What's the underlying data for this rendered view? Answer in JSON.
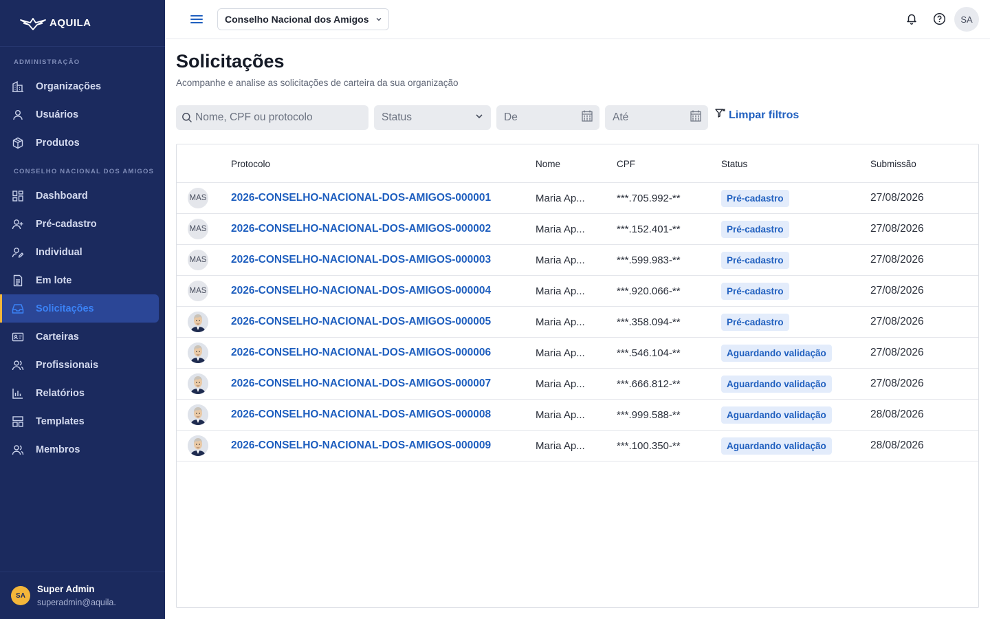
{
  "brand": {
    "name": "AQUILA"
  },
  "sidebar": {
    "section_admin": "ADMINISTRAÇÃO",
    "admin_items": [
      {
        "label": "Organizações",
        "icon": "building-icon"
      },
      {
        "label": "Usuários",
        "icon": "user-icon"
      },
      {
        "label": "Produtos",
        "icon": "package-icon"
      }
    ],
    "section_org": "CONSELHO NACIONAL DOS AMIGOS",
    "org_items": [
      {
        "label": "Dashboard",
        "icon": "dashboard-icon"
      },
      {
        "label": "Pré-cadastro",
        "icon": "user-plus-icon"
      },
      {
        "label": "Individual",
        "icon": "user-edit-icon"
      },
      {
        "label": "Em lote",
        "icon": "sheet-icon"
      },
      {
        "label": "Solicitações",
        "icon": "inbox-icon",
        "active": true
      },
      {
        "label": "Carteiras",
        "icon": "id-card-icon"
      },
      {
        "label": "Profissionais",
        "icon": "users-icon"
      },
      {
        "label": "Relatórios",
        "icon": "bar-chart-icon"
      },
      {
        "label": "Templates",
        "icon": "template-icon"
      },
      {
        "label": "Membros",
        "icon": "members-icon"
      }
    ],
    "user": {
      "initials": "SA",
      "name": "Super Admin",
      "email": "superadmin@aquila."
    }
  },
  "topbar": {
    "org_name": "Conselho Nacional dos Amigos",
    "avatar_initials": "SA"
  },
  "page": {
    "title": "Solicitações",
    "subtitle": "Acompanhe e analise as solicitações de carteira da sua organização"
  },
  "filters": {
    "search_placeholder": "Nome, CPF ou protocolo",
    "status_placeholder": "Status",
    "from_placeholder": "De",
    "to_placeholder": "Até",
    "clear_label": "Limpar filtros"
  },
  "table": {
    "headers": {
      "protocolo": "Protocolo",
      "nome": "Nome",
      "cpf": "CPF",
      "status": "Status",
      "submissao": "Submissão"
    },
    "rows": [
      {
        "avatar": "MAS",
        "protocolo": "2026-CONSELHO-NACIONAL-DOS-AMIGOS-000001",
        "nome": "Maria Ap...",
        "cpf": "***.705.992-**",
        "status": "Pré-cadastro",
        "submissao": "27/08/2026"
      },
      {
        "avatar": "MAS",
        "protocolo": "2026-CONSELHO-NACIONAL-DOS-AMIGOS-000002",
        "nome": "Maria Ap...",
        "cpf": "***.152.401-**",
        "status": "Pré-cadastro",
        "submissao": "27/08/2026"
      },
      {
        "avatar": "MAS",
        "protocolo": "2026-CONSELHO-NACIONAL-DOS-AMIGOS-000003",
        "nome": "Maria Ap...",
        "cpf": "***.599.983-**",
        "status": "Pré-cadastro",
        "submissao": "27/08/2026"
      },
      {
        "avatar": "MAS",
        "protocolo": "2026-CONSELHO-NACIONAL-DOS-AMIGOS-000004",
        "nome": "Maria Ap...",
        "cpf": "***.920.066-**",
        "status": "Pré-cadastro",
        "submissao": "27/08/2026"
      },
      {
        "avatar": "photo",
        "protocolo": "2026-CONSELHO-NACIONAL-DOS-AMIGOS-000005",
        "nome": "Maria Ap...",
        "cpf": "***.358.094-**",
        "status": "Pré-cadastro",
        "submissao": "27/08/2026"
      },
      {
        "avatar": "photo",
        "protocolo": "2026-CONSELHO-NACIONAL-DOS-AMIGOS-000006",
        "nome": "Maria Ap...",
        "cpf": "***.546.104-**",
        "status": "Aguardando validação",
        "submissao": "27/08/2026"
      },
      {
        "avatar": "photo",
        "protocolo": "2026-CONSELHO-NACIONAL-DOS-AMIGOS-000007",
        "nome": "Maria Ap...",
        "cpf": "***.666.812-**",
        "status": "Aguardando validação",
        "submissao": "27/08/2026"
      },
      {
        "avatar": "photo",
        "protocolo": "2026-CONSELHO-NACIONAL-DOS-AMIGOS-000008",
        "nome": "Maria Ap...",
        "cpf": "***.999.588-**",
        "status": "Aguardando validação",
        "submissao": "28/08/2026"
      },
      {
        "avatar": "photo",
        "protocolo": "2026-CONSELHO-NACIONAL-DOS-AMIGOS-000009",
        "nome": "Maria Ap...",
        "cpf": "***.100.350-**",
        "status": "Aguardando validação",
        "submissao": "28/08/2026"
      }
    ]
  },
  "colors": {
    "sidebar_bg": "#1b2a5e",
    "accent": "#1f5fbf",
    "active_bar": "#f3b63a",
    "badge_bg": "#e3ecfb"
  }
}
